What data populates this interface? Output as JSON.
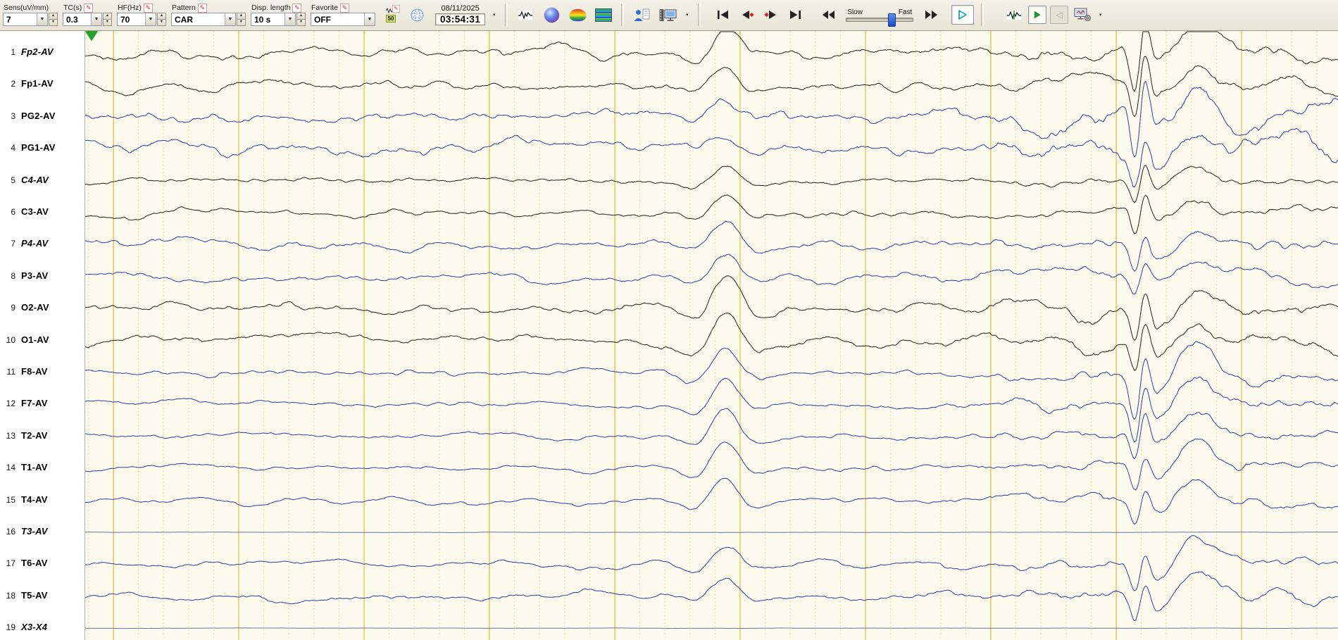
{
  "icons": {
    "edit_pencil": "✎",
    "spinner_up": "▲",
    "spinner_down": "▼",
    "dropdown": "▾",
    "combo_arrow": "▼",
    "prev_page": "◁"
  },
  "toolbar": {
    "fields": [
      {
        "key": "sens",
        "label": "Sens(uV/mm)",
        "value": "7",
        "editable": false,
        "spinner": true
      },
      {
        "key": "tc",
        "label": "TC(s)",
        "value": "0.3",
        "editable": true,
        "spinner": true
      },
      {
        "key": "hf",
        "label": "HF(Hz)",
        "value": "70",
        "editable": true,
        "spinner": true
      },
      {
        "key": "pattern",
        "label": "Pattern",
        "value": "CAR",
        "editable": true,
        "spinner": true
      },
      {
        "key": "disp",
        "label": "Disp. length",
        "value": "10 s",
        "editable": true,
        "spinner": true
      },
      {
        "key": "favorite",
        "label": "Favorite",
        "value": "OFF",
        "editable": true,
        "spinner": false
      }
    ],
    "notch_label": "50",
    "date": "08/11/2025",
    "time": "03:54:31",
    "speed": {
      "slow": "Slow",
      "fast": "Fast"
    }
  },
  "channels": [
    {
      "num": "1",
      "label": "Fp2-AV",
      "italic": true,
      "color": "black"
    },
    {
      "num": "2",
      "label": "Fp1-AV",
      "italic": false,
      "color": "black"
    },
    {
      "num": "3",
      "label": "PG2-AV",
      "italic": false,
      "color": "blue"
    },
    {
      "num": "4",
      "label": "PG1-AV",
      "italic": false,
      "color": "blue"
    },
    {
      "num": "5",
      "label": "C4-AV",
      "italic": true,
      "color": "black"
    },
    {
      "num": "6",
      "label": "C3-AV",
      "italic": false,
      "color": "black"
    },
    {
      "num": "7",
      "label": "P4-AV",
      "italic": true,
      "color": "blue"
    },
    {
      "num": "8",
      "label": "P3-AV",
      "italic": false,
      "color": "blue"
    },
    {
      "num": "9",
      "label": "O2-AV",
      "italic": false,
      "color": "black"
    },
    {
      "num": "10",
      "label": "O1-AV",
      "italic": false,
      "color": "black"
    },
    {
      "num": "11",
      "label": "F8-AV",
      "italic": false,
      "color": "blue"
    },
    {
      "num": "12",
      "label": "F7-AV",
      "italic": false,
      "color": "blue"
    },
    {
      "num": "13",
      "label": "T2-AV",
      "italic": false,
      "color": "blue"
    },
    {
      "num": "14",
      "label": "T1-AV",
      "italic": false,
      "color": "blue"
    },
    {
      "num": "15",
      "label": "T4-AV",
      "italic": false,
      "color": "blue"
    },
    {
      "num": "16",
      "label": "T3-AV",
      "italic": true,
      "color": "flat"
    },
    {
      "num": "17",
      "label": "T6-AV",
      "italic": false,
      "color": "blue"
    },
    {
      "num": "18",
      "label": "T5-AV",
      "italic": false,
      "color": "blue"
    },
    {
      "num": "19",
      "label": "X3-X4",
      "italic": true,
      "color": "flat"
    }
  ],
  "display": {
    "seconds": 10,
    "colors": {
      "background": "#fcfaec",
      "grid_major": "#dfc543",
      "grid_minor": "#e9da85",
      "trace_black": "#23201b",
      "trace_blue": "#2940a6",
      "trace_flat": "#5c79a6",
      "marker_green": "#24a32b"
    }
  }
}
